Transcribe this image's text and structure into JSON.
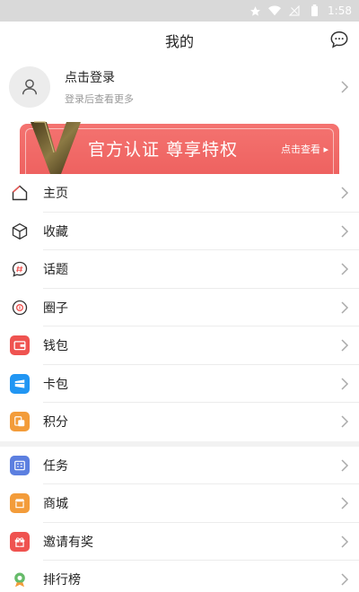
{
  "status": {
    "time": "1:58"
  },
  "header": {
    "title": "我的"
  },
  "profile": {
    "login_label": "点击登录",
    "login_sub": "登录后查看更多"
  },
  "vip": {
    "logo_letter": "V",
    "title": "官方认证  尊享特权",
    "link_label": "点击查看 ▸",
    "colors": {
      "banner": "#f06b69",
      "logo": "#7a6a3a"
    }
  },
  "menu1": [
    {
      "label": "主页",
      "icon": "home-icon"
    },
    {
      "label": "收藏",
      "icon": "box-icon"
    },
    {
      "label": "话题",
      "icon": "hashtag-icon"
    },
    {
      "label": "圈子",
      "icon": "circle-icon"
    },
    {
      "label": "钱包",
      "icon": "wallet-icon",
      "color": "#ef5350"
    },
    {
      "label": "卡包",
      "icon": "card-icon",
      "color": "#2196f3"
    },
    {
      "label": "积分",
      "icon": "points-icon",
      "color": "#f39c3a"
    }
  ],
  "menu2": [
    {
      "label": "任务",
      "icon": "task-icon",
      "color": "#5c7fe0"
    },
    {
      "label": "商城",
      "icon": "shop-icon",
      "color": "#f39c3a"
    },
    {
      "label": "邀请有奖",
      "icon": "gift-icon",
      "color": "#ef5350"
    },
    {
      "label": "排行榜",
      "icon": "ranking-icon",
      "color": "#66bb6a"
    }
  ]
}
